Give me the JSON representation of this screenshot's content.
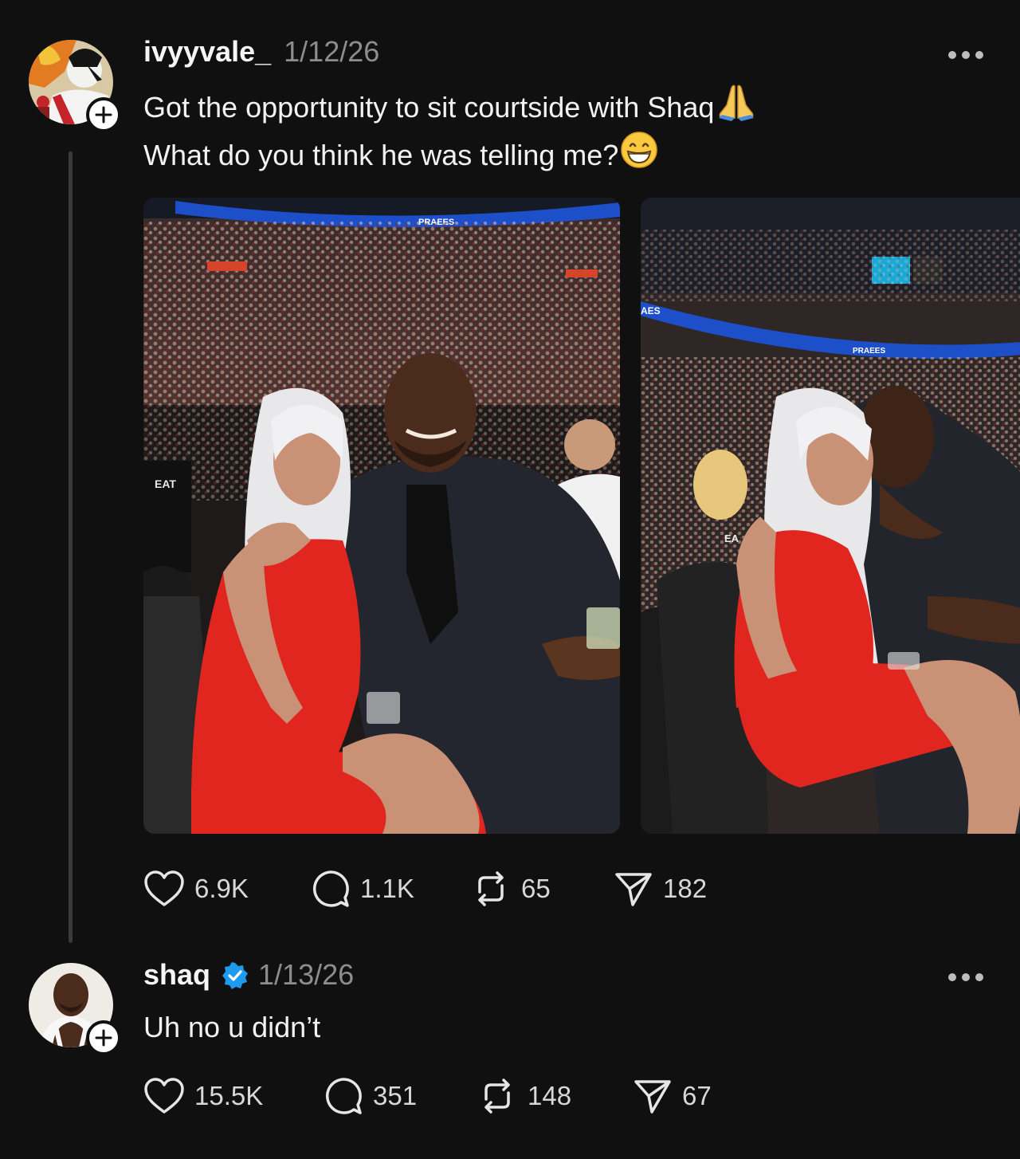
{
  "posts": [
    {
      "username": "ivyyvale_",
      "date": "1/12/26",
      "lines": [
        "Got the opportunity to sit courtside with Shaq",
        "What do you think he was telling me?"
      ],
      "line_emojis": [
        "folded-hands",
        "grinning-face"
      ],
      "stats": {
        "likes": "6.9K",
        "replies": "1.1K",
        "reposts": "65",
        "shares": "182"
      }
    },
    {
      "username": "shaq",
      "verified": true,
      "date": "1/13/26",
      "lines": [
        "Uh no u didn’t"
      ],
      "stats": {
        "likes": "15.5K",
        "replies": "351",
        "reposts": "148",
        "shares": "67"
      }
    }
  ],
  "photos": [
    {
      "arena_banner": "PRAEES",
      "shirt_text": "EAT"
    },
    {
      "arena_banner": "PRAEES",
      "side_text": "AES",
      "shirt_text": "EA"
    }
  ],
  "colors": {
    "background": "#101010",
    "verified": "#1d9bf0",
    "dress": "#e0261f",
    "banner": "#1c4fc8"
  },
  "icons": [
    "more-icon",
    "heart-icon",
    "reply-icon",
    "repost-icon",
    "share-icon",
    "follow-plus-icon",
    "verified-badge-icon"
  ]
}
